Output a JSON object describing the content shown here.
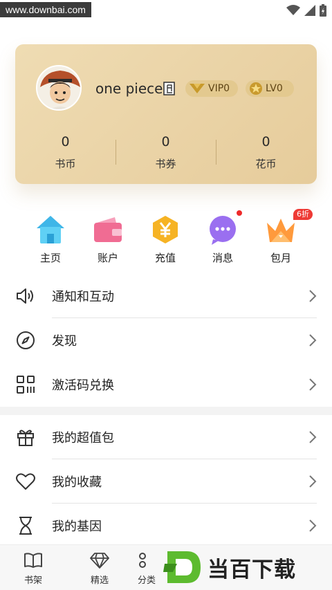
{
  "watermark": "www.downbai.com",
  "profile": {
    "name": "one piece",
    "vip": "VIP0",
    "level": "LV0",
    "stats": [
      {
        "value": "0",
        "label": "书币"
      },
      {
        "value": "0",
        "label": "书券"
      },
      {
        "value": "0",
        "label": "花币"
      }
    ]
  },
  "quick": [
    {
      "label": "主页",
      "icon": "house-icon"
    },
    {
      "label": "账户",
      "icon": "wallet-icon"
    },
    {
      "label": "充值",
      "icon": "yen-coin-icon"
    },
    {
      "label": "消息",
      "icon": "message-icon"
    },
    {
      "label": "包月",
      "icon": "crown-icon",
      "badge": "6折"
    }
  ],
  "menu_group1": [
    {
      "label": "通知和互动",
      "icon": "speaker-icon"
    },
    {
      "label": "发现",
      "icon": "compass-icon"
    },
    {
      "label": "激活码兑换",
      "icon": "qr-grid-icon"
    }
  ],
  "menu_group2": [
    {
      "label": "我的超值包",
      "icon": "gift-icon"
    },
    {
      "label": "我的收藏",
      "icon": "heart-icon"
    },
    {
      "label": "我的基因",
      "icon": "dna-icon"
    }
  ],
  "tabs": [
    {
      "label": "书架",
      "icon": "book-icon"
    },
    {
      "label": "精选",
      "icon": "diamond-icon"
    },
    {
      "label": "分类",
      "icon": "grid-icon"
    }
  ],
  "logo_overlay": "当百下载",
  "colors": {
    "card": "#ead3a6",
    "badge": "#e3c98f",
    "accent_red": "#ee3a35",
    "logo_green": "#5dbb2f"
  }
}
